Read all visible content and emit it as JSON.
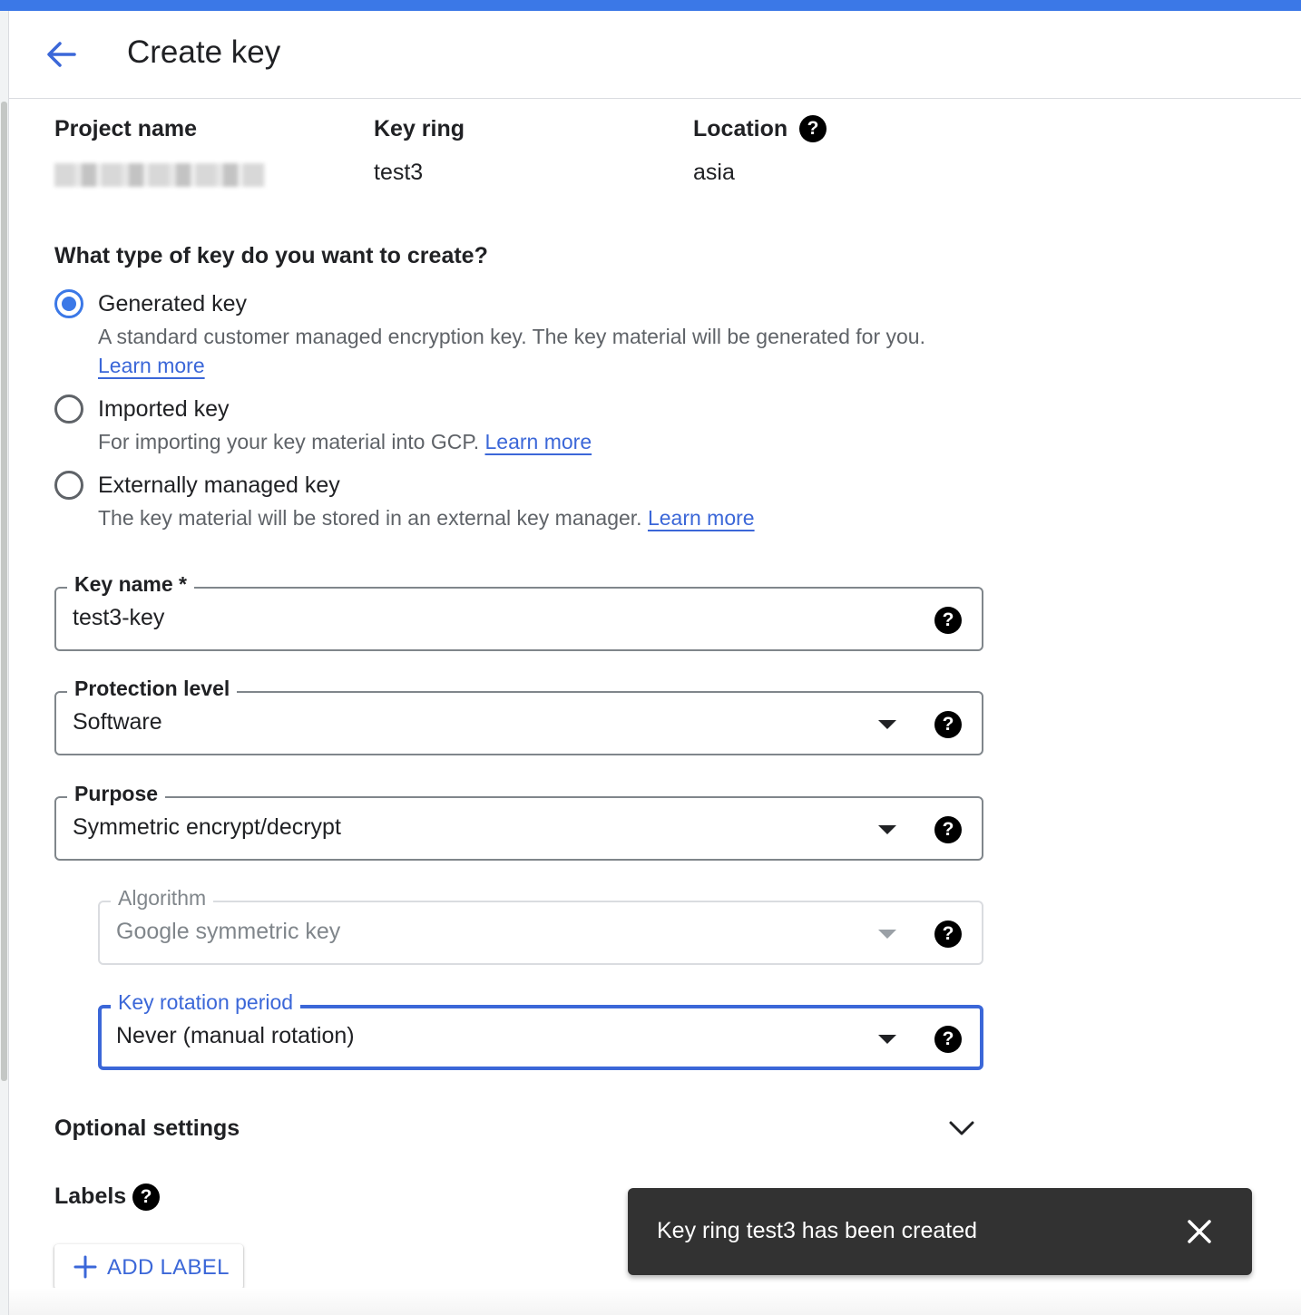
{
  "header": {
    "title": "Create key"
  },
  "meta": {
    "project_label": "Project name",
    "key_ring_label": "Key ring",
    "key_ring_value": "test3",
    "location_label": "Location",
    "location_value": "asia"
  },
  "key_type": {
    "question": "What type of key do you want to create?",
    "options": [
      {
        "label": "Generated key",
        "desc": "A standard customer managed encryption key. The key material will be generated for you.",
        "link": "Learn more",
        "selected": true
      },
      {
        "label": "Imported key",
        "desc": "For importing your key material into GCP.",
        "link": "Learn more",
        "selected": false
      },
      {
        "label": "Externally managed key",
        "desc": "The key material will be stored in an external key manager.",
        "link": "Learn more",
        "selected": false
      }
    ]
  },
  "fields": {
    "key_name": {
      "label": "Key name *",
      "value": "test3-key"
    },
    "protection_level": {
      "label": "Protection level",
      "value": "Software"
    },
    "purpose": {
      "label": "Purpose",
      "value": "Symmetric encrypt/decrypt"
    },
    "algorithm": {
      "label": "Algorithm",
      "value": "Google symmetric key",
      "disabled": true
    },
    "rotation": {
      "label": "Key rotation period",
      "value": "Never (manual rotation)",
      "focused": true
    }
  },
  "optional_settings": {
    "title": "Optional settings"
  },
  "labels": {
    "title": "Labels",
    "add_button": "ADD LABEL"
  },
  "snackbar": {
    "message": "Key ring test3 has been created"
  },
  "colors": {
    "accent": "#3b78e7",
    "link": "#3b67d8",
    "snackbar_bg": "#323232"
  }
}
